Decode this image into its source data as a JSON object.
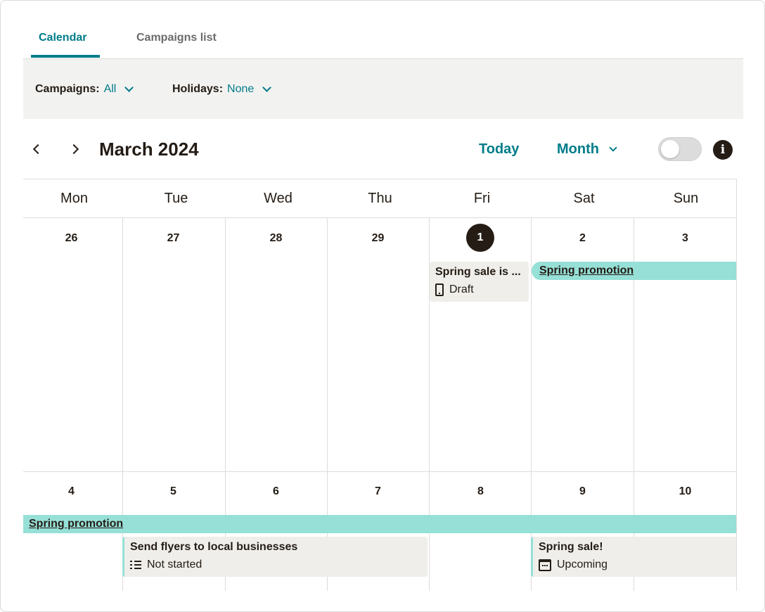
{
  "tabs": [
    {
      "label": "Calendar",
      "active": true
    },
    {
      "label": "Campaigns list",
      "active": false
    }
  ],
  "filters": {
    "campaigns_label": "Campaigns:",
    "campaigns_value": "All",
    "holidays_label": "Holidays:",
    "holidays_value": "None"
  },
  "header": {
    "month_title": "March 2024",
    "today_label": "Today",
    "view_label": "Month",
    "info_glyph": "i"
  },
  "weekdays": [
    "Mon",
    "Tue",
    "Wed",
    "Thu",
    "Fri",
    "Sat",
    "Sun"
  ],
  "weeks": [
    {
      "days": [
        "26",
        "27",
        "28",
        "29",
        "1",
        "2",
        "3"
      ]
    },
    {
      "days": [
        "4",
        "5",
        "6",
        "7",
        "8",
        "9",
        "10"
      ]
    }
  ],
  "today_day": "1",
  "events": {
    "spring_promotion_label": "Spring promotion",
    "spring_sale_draft": {
      "title": "Spring sale is ...",
      "status": "Draft",
      "icon": "phone-icon"
    },
    "send_flyers": {
      "title": "Send flyers to local businesses",
      "status": "Not started",
      "icon": "list-icon"
    },
    "spring_sale": {
      "title": "Spring sale!",
      "status": "Upcoming",
      "icon": "calendar-icon"
    }
  },
  "colors": {
    "accent": "#007c89",
    "event_bar": "#96e0d7",
    "card_bg": "#efeeea",
    "text": "#241c15"
  }
}
